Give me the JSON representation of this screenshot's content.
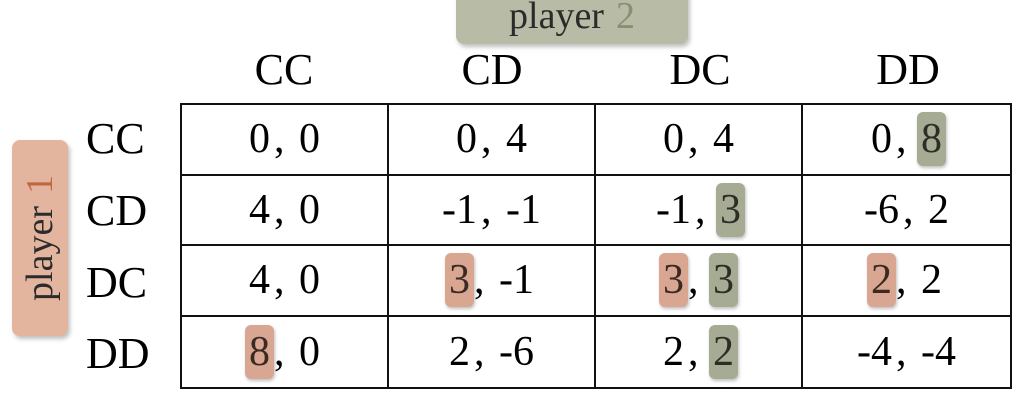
{
  "player2_label": {
    "text": "player",
    "number": "2"
  },
  "player1_label": {
    "text": "player",
    "number": "1"
  },
  "column_headers": [
    "CC",
    "CD",
    "DC",
    "DD"
  ],
  "row_headers": [
    "CC",
    "CD",
    "DC",
    "DD"
  ],
  "colors": {
    "player1_highlight": "#d9a791",
    "player2_highlight": "#a6ab93",
    "player1_badge": "#e3b59e",
    "player2_badge": "#b8bba6"
  },
  "matrix": [
    [
      {
        "p1": "0",
        "p2": "0",
        "h1": false,
        "h2": false
      },
      {
        "p1": "0",
        "p2": "4",
        "h1": false,
        "h2": false
      },
      {
        "p1": "0",
        "p2": "4",
        "h1": false,
        "h2": false
      },
      {
        "p1": "0",
        "p2": "8",
        "h1": false,
        "h2": true
      }
    ],
    [
      {
        "p1": "4",
        "p2": "0",
        "h1": false,
        "h2": false
      },
      {
        "p1": "-1",
        "p2": "-1",
        "h1": false,
        "h2": false
      },
      {
        "p1": "-1",
        "p2": "3",
        "h1": false,
        "h2": true
      },
      {
        "p1": "-6",
        "p2": "2",
        "h1": false,
        "h2": false
      }
    ],
    [
      {
        "p1": "4",
        "p2": "0",
        "h1": false,
        "h2": false
      },
      {
        "p1": "3",
        "p2": "-1",
        "h1": true,
        "h2": false
      },
      {
        "p1": "3",
        "p2": "3",
        "h1": true,
        "h2": true
      },
      {
        "p1": "2",
        "p2": "2",
        "h1": true,
        "h2": false
      }
    ],
    [
      {
        "p1": "8",
        "p2": "0",
        "h1": true,
        "h2": false
      },
      {
        "p1": "2",
        "p2": "-6",
        "h1": false,
        "h2": false
      },
      {
        "p1": "2",
        "p2": "2",
        "h1": false,
        "h2": true
      },
      {
        "p1": "-4",
        "p2": "-4",
        "h1": false,
        "h2": false
      }
    ]
  ]
}
